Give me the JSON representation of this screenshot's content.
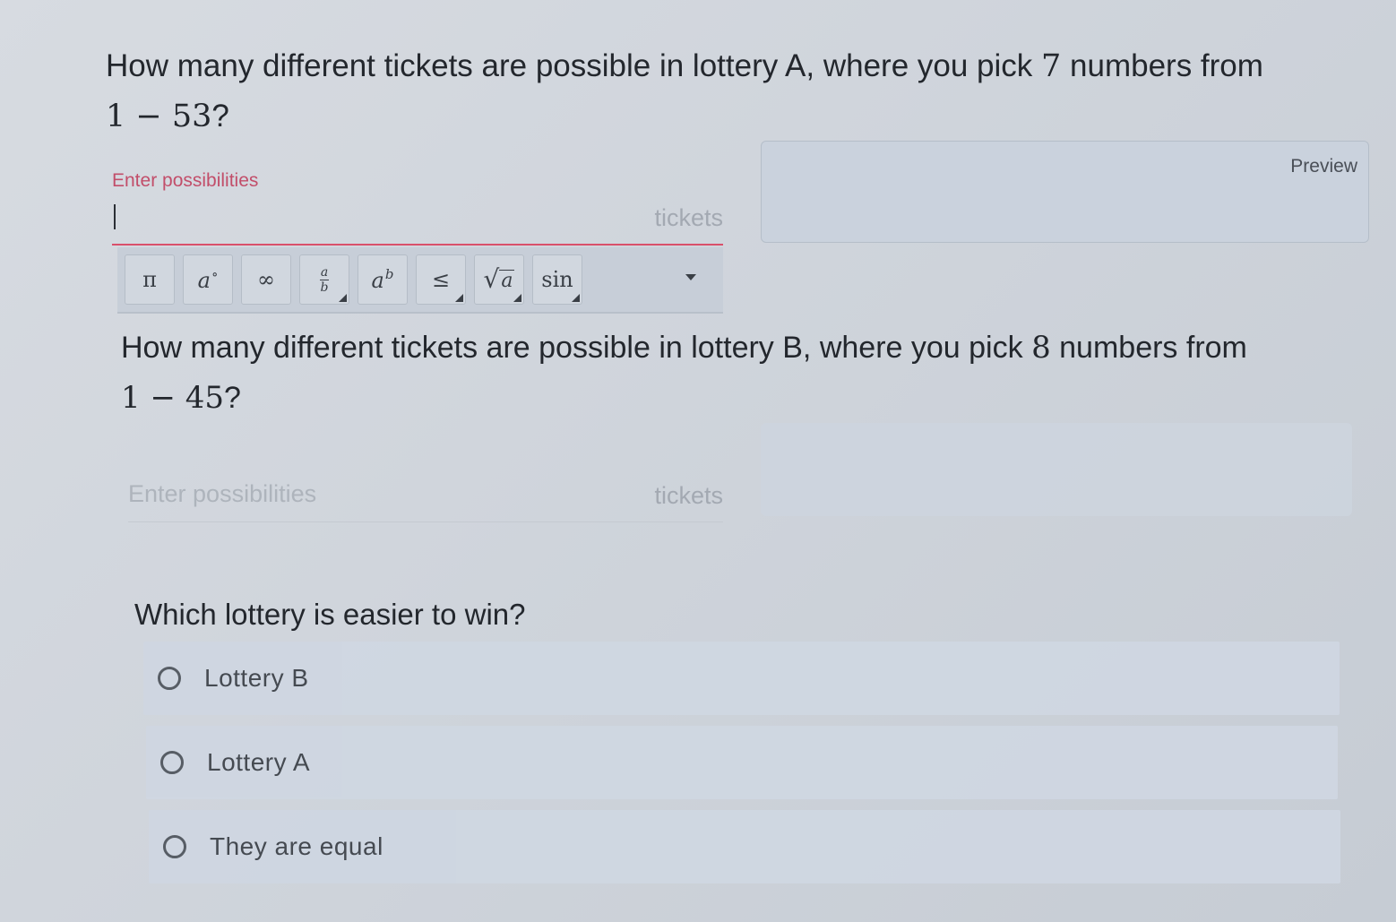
{
  "question1": {
    "text_before": "How many different tickets are possible in lottery A, where you pick ",
    "pick_count": "7",
    "text_after": " numbers from",
    "range": "1 − 53",
    "range_end": "?",
    "field_label": "Enter possibilities",
    "suffix": "tickets",
    "preview_label": "Preview"
  },
  "toolbar": {
    "buttons": [
      {
        "icon": "pi-icon",
        "glyph": "π"
      },
      {
        "icon": "degree-icon",
        "glyph": "a",
        "sup": "∘"
      },
      {
        "icon": "infinity-icon",
        "glyph": "∞"
      },
      {
        "icon": "fraction-icon",
        "num": "a",
        "den": "b"
      },
      {
        "icon": "exponent-icon",
        "glyph": "a",
        "sup": "b"
      },
      {
        "icon": "less-equal-icon",
        "glyph": "≤"
      },
      {
        "icon": "sqrt-icon",
        "rad": "√",
        "under": "a"
      },
      {
        "icon": "sin-icon",
        "glyph": "sin"
      }
    ]
  },
  "question2": {
    "text_before": "How many different tickets are possible in lottery B, where you pick ",
    "pick_count": "8",
    "text_after": " numbers from",
    "range": "1 − 45",
    "range_end": "?",
    "placeholder": "Enter possibilities",
    "suffix": "tickets"
  },
  "question3": {
    "text": "Which lottery is easier to win?",
    "options": [
      {
        "label": "Lottery B"
      },
      {
        "label": "Lottery A"
      },
      {
        "label": "They are equal"
      }
    ]
  }
}
